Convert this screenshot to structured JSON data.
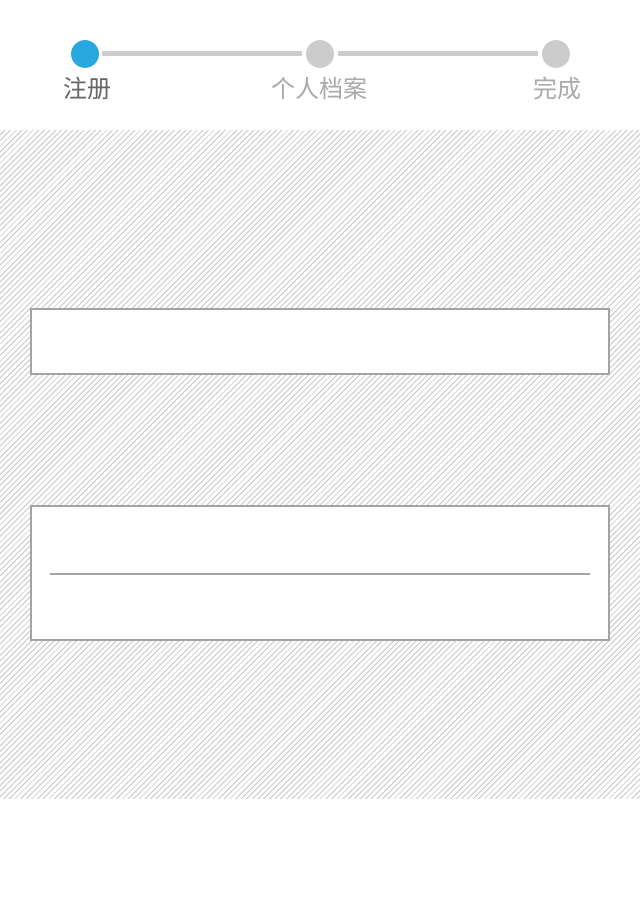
{
  "colors": {
    "accent": "#29a8e0",
    "inactive": "#cccccc",
    "label_active": "#666666",
    "label_inactive": "#aaaaaa",
    "field_border": "#a4a4a4"
  },
  "stepper": {
    "steps": [
      {
        "label": "注册",
        "state": "active"
      },
      {
        "label": "个人档案",
        "state": "inactive"
      },
      {
        "label": "完成",
        "state": "inactive"
      }
    ]
  },
  "form": {
    "field_single": {
      "value": "",
      "placeholder": ""
    },
    "field_group": [
      {
        "value": "",
        "placeholder": ""
      },
      {
        "value": "",
        "placeholder": ""
      }
    ]
  }
}
